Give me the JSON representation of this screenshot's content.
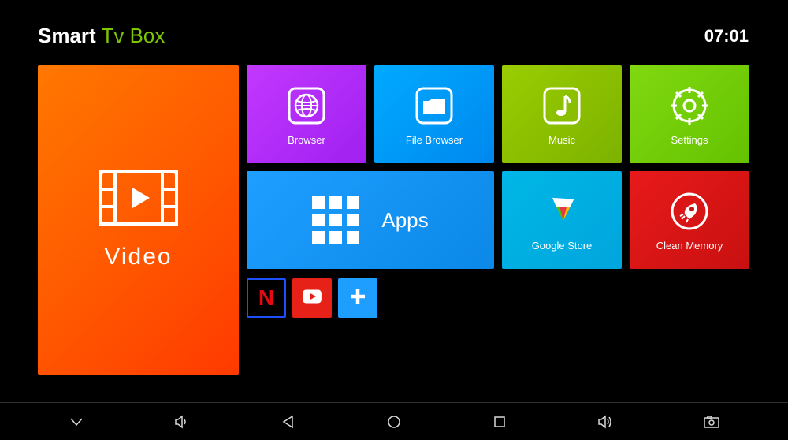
{
  "header": {
    "logo_smart": "Smart",
    "logo_tv": "Tv",
    "logo_box": "Box",
    "clock": "07:01"
  },
  "tiles": {
    "video": "Video",
    "browser": "Browser",
    "file_browser": "File Browser",
    "music": "Music",
    "settings": "Settings",
    "apps": "Apps",
    "google_store": "Google Store",
    "clean_memory": "Clean Memory"
  },
  "shortcuts": {
    "netflix": "N",
    "youtube": "YouTube",
    "add": "Add"
  },
  "nav": {
    "dismiss": "dismiss",
    "vol_down": "volume down",
    "back": "back",
    "home": "home",
    "recent": "recent",
    "vol_up": "volume up",
    "screenshot": "screenshot"
  }
}
